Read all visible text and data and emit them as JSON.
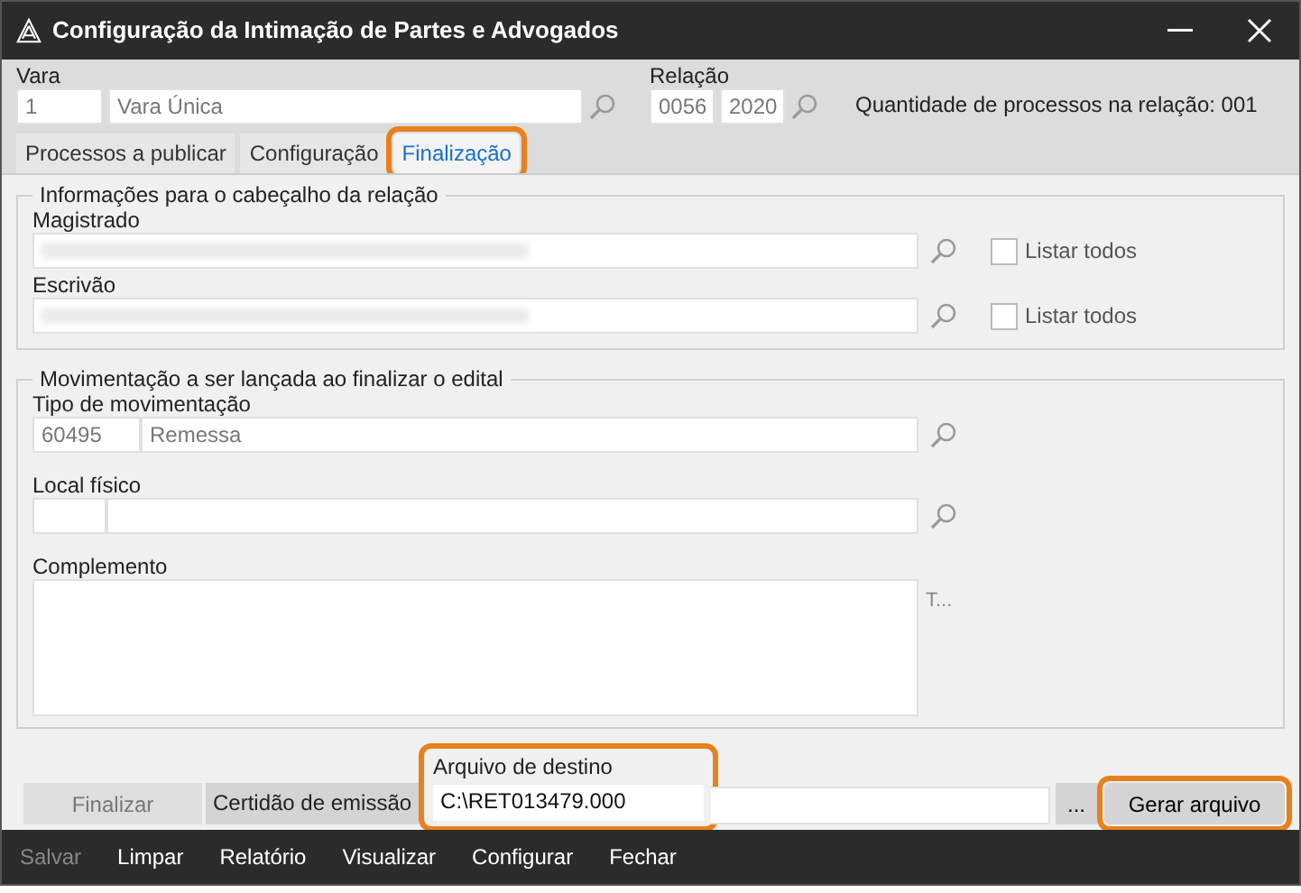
{
  "window": {
    "title": "Configuração da Intimação de Partes e Advogados"
  },
  "header": {
    "vara": {
      "label": "Vara",
      "code": "1",
      "name": "Vara Única"
    },
    "relacao": {
      "label": "Relação",
      "number": "0056",
      "year": "2020"
    },
    "count_text": "Quantidade de processos na relação: 001"
  },
  "tabs": [
    {
      "label": "Processos a publicar",
      "selected": false,
      "highlighted": false
    },
    {
      "label": "Configuração",
      "selected": false,
      "highlighted": false
    },
    {
      "label": "Finalização",
      "selected": true,
      "highlighted": true
    }
  ],
  "header_group": {
    "title": "Informações para o cabeçalho da relação",
    "fields": [
      {
        "label": "Magistrado",
        "redacted": true,
        "list_all": {
          "label": "Listar todos",
          "checked": false
        }
      },
      {
        "label": "Escrivão",
        "redacted": true,
        "list_all": {
          "label": "Listar todos",
          "checked": false
        }
      }
    ]
  },
  "movement_group": {
    "title": "Movimentação a ser lançada ao finalizar o edital",
    "tipo": {
      "label": "Tipo de movimentação",
      "code": "60495",
      "name": "Remessa"
    },
    "local": {
      "label": "Local físico"
    },
    "complemento": {
      "label": "Complemento",
      "side_text": "T..."
    }
  },
  "footer": {
    "finalizar": {
      "label": "Finalizar",
      "disabled": true
    },
    "certidao": "Certidão de emissão",
    "destino": {
      "label": "Arquivo de destino",
      "value": "C:\\RET013479.000",
      "highlighted": true
    },
    "browse": "...",
    "gerar": {
      "label": "Gerar arquivo",
      "highlighted": true
    }
  },
  "toolbar": [
    {
      "label": "Salvar",
      "disabled": true
    },
    {
      "label": "Limpar",
      "disabled": false
    },
    {
      "label": "Relatório",
      "disabled": false
    },
    {
      "label": "Visualizar",
      "disabled": false
    },
    {
      "label": "Configurar",
      "disabled": false
    },
    {
      "label": "Fechar",
      "disabled": false
    }
  ]
}
